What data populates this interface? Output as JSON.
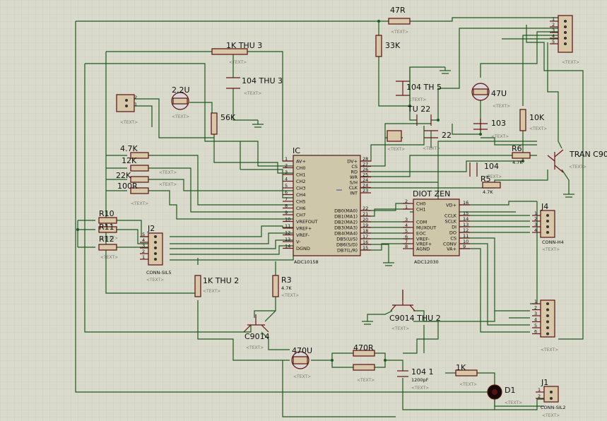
{
  "text_placeholder": "<TEXT>",
  "components": {
    "r_47r_top": "47R",
    "r_33k": "33K",
    "r_1k_thu3": "1K THU 3",
    "c_104_thu3": "104 THU 3",
    "c_104_th5": "104 TH 5",
    "c_47u": "47U",
    "cap_2_2u": "2.2U",
    "r_56k": "56K",
    "tu22": "TU 22",
    "c_22": "22",
    "c_103": "103",
    "r_10k": "10K",
    "r_4_7k": "4.7K",
    "r_12k": "12K",
    "r_22k": "22K",
    "r_100r": "100R",
    "r10": "R10",
    "r11": "R11",
    "r12": "R12",
    "r6": "R6",
    "r6_val": "4.7K",
    "r5": "R5",
    "r5_val": "4.7K",
    "c_104": "104",
    "tran": "TRAN C9014",
    "r_1k_thu2": "1K THU 2",
    "r3": "R3",
    "r3_val": "4.7K",
    "c9014": "C9014",
    "c9014_thu2": "C9014 THU 2",
    "c_470u": "470U",
    "r_470r": "470R",
    "c_104_1": "104 1",
    "c_104_1_val": "1200pF",
    "r_1k": "1K",
    "d1": "D1",
    "j1": "J1",
    "j1_type": "CONN-SIL2",
    "j2": "J2",
    "j2_type": "CONN-SIL5",
    "j4": "J4",
    "j4_type": "CONN-H4",
    "conn_small_2": "2",
    "conn_small_1": "1"
  },
  "ic1": {
    "label": "IC",
    "part": "ADC10158",
    "left_pins": [
      {
        "num": "1",
        "name": "AV+"
      },
      {
        "num": "2",
        "name": "CH0"
      },
      {
        "num": "3",
        "name": "CH1"
      },
      {
        "num": "4",
        "name": "CH2"
      },
      {
        "num": "5",
        "name": "CH3"
      },
      {
        "num": "6",
        "name": "CH4"
      },
      {
        "num": "7",
        "name": "CH5"
      },
      {
        "num": "8",
        "name": "CH6"
      },
      {
        "num": "9",
        "name": "CH7"
      },
      {
        "num": "10",
        "name": "VREFOUT"
      },
      {
        "num": "11",
        "name": "VREF+"
      },
      {
        "num": "12",
        "name": "VREF-"
      },
      {
        "num": "13",
        "name": "V-"
      },
      {
        "num": "14",
        "name": "DGND"
      }
    ],
    "right_pins": [
      {
        "num": "28",
        "name": "DV+"
      },
      {
        "num": "27",
        "name": "CS"
      },
      {
        "num": "26",
        "name": "RD"
      },
      {
        "num": "25",
        "name": "WR"
      },
      {
        "num": "24",
        "name": "S/H"
      },
      {
        "num": "24",
        "name": "CLK"
      },
      {
        "num": "23",
        "name": "INT"
      },
      {
        "num": "22",
        "name": "DB0(MA0)"
      },
      {
        "num": "21",
        "name": "DB1(MA1)"
      },
      {
        "num": "20",
        "name": "DB2(MA2)"
      },
      {
        "num": "19",
        "name": "DB3(MA3)"
      },
      {
        "num": "18",
        "name": "DB4(MA4)"
      },
      {
        "num": "17",
        "name": "DB5(U/S)"
      },
      {
        "num": "16",
        "name": "DB6(S/D)"
      },
      {
        "num": "15",
        "name": "DB7(L/R)"
      }
    ]
  },
  "ic2": {
    "label": "DIOT ZEN",
    "part": "ADC12030",
    "left_pins": [
      {
        "num": "2",
        "name": "CH0"
      },
      {
        "num": "1",
        "name": "CH1"
      },
      {
        "num": "3",
        "name": "COM"
      },
      {
        "num": "4",
        "name": "MUXOUT"
      },
      {
        "num": "5",
        "name": "EOC"
      },
      {
        "num": "6",
        "name": "VREF-"
      },
      {
        "num": "7",
        "name": "VREF+"
      },
      {
        "num": "8",
        "name": "AGND"
      }
    ],
    "right_pins": [
      {
        "num": "16",
        "name": "VD+"
      },
      {
        "num": "15",
        "name": "CCLK"
      },
      {
        "num": "14",
        "name": "SCLK"
      },
      {
        "num": "13",
        "name": "DI"
      },
      {
        "num": "12",
        "name": "DO"
      },
      {
        "num": "11",
        "name": "CS"
      },
      {
        "num": "10",
        "name": "CONV"
      },
      {
        "num": "9",
        "name": "VA+"
      }
    ]
  },
  "conn_top": {
    "pins": [
      "1",
      "2",
      "3",
      "4",
      "5"
    ]
  },
  "conn_j2": {
    "pins": [
      "5",
      "4",
      "3",
      "2",
      "1"
    ]
  },
  "conn_j4": {
    "pins": [
      "1",
      "2",
      "3",
      "4"
    ]
  },
  "conn_right": {
    "pins": [
      "1",
      "2",
      "3",
      "4",
      "5",
      "6"
    ]
  },
  "conn_j1": {
    "pins": [
      "1",
      "2"
    ]
  }
}
